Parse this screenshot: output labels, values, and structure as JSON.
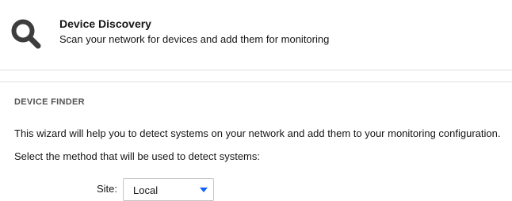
{
  "header": {
    "icon": "search-icon",
    "title": "Device Discovery",
    "subtitle": "Scan your network for devices and add them for monitoring"
  },
  "device_finder": {
    "section_title": "DEVICE FINDER",
    "description": "This wizard will help you to detect systems on your network and add them to your monitoring configuration.",
    "method_prompt": "Select the method that will be used to detect systems:",
    "site": {
      "label": "Site:",
      "value": "Local",
      "icon": "chevron-down-icon"
    }
  },
  "colors": {
    "icon": "#3d3d3d",
    "accent": "#0f62fe",
    "border": "#e0e0e0"
  }
}
